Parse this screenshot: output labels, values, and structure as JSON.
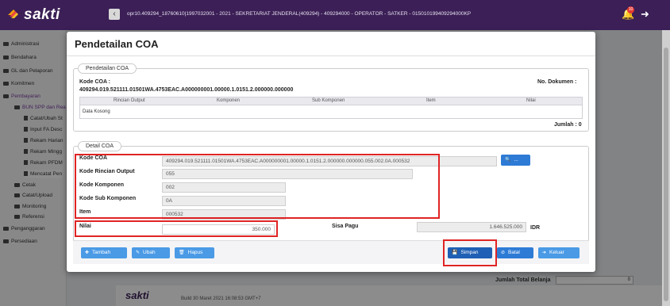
{
  "app": {
    "logo_text": "sakti",
    "context_line": "opr10.409294_18760610|1997032001 - 2021 - SEKRETARIAT JENDERAL(409294) - 409294000 - OPERATOR - SATKER - 015010199409294000KP",
    "notification_count": "10"
  },
  "sidebar": {
    "items": [
      {
        "label": "Administrasi"
      },
      {
        "label": "Bendahara"
      },
      {
        "label": "GL dan Pelaporan"
      },
      {
        "label": "Komitmen"
      },
      {
        "label": "Pembayaran"
      },
      {
        "label": "BUN SPP dan Rea"
      },
      {
        "label": "Catat/Ubah St"
      },
      {
        "label": "Input FA Desc"
      },
      {
        "label": "Rekam Harian"
      },
      {
        "label": "Rekam Mingg"
      },
      {
        "label": "Rekam PFDM"
      },
      {
        "label": "Mencatat Pen"
      },
      {
        "label": "Cetak"
      },
      {
        "label": "Catat/Upload"
      },
      {
        "label": "Monitoring"
      },
      {
        "label": "Referensi"
      },
      {
        "label": "Penganggaran"
      },
      {
        "label": "Persediaan"
      }
    ]
  },
  "background": {
    "footer_logo": "sakti",
    "build": "Build 30 Maret 2021 16:08:53 GMT+7",
    "total_belanja_label": "Jumlah Total Belanja",
    "total_belanja_value": "0"
  },
  "modal": {
    "title": "Pendetailan COA",
    "section1": {
      "legend": "Pendetailan COA",
      "kode_coa_label": "Kode COA :",
      "kode_coa_value": "409294.019.521111.01501WA.4753EAC.A000000001.00000.1.0151.2.000000.000000",
      "no_dokumen_label": "No. Dokumen :",
      "columns": [
        "Rincian Output",
        "Komponen",
        "Sub Komponen",
        "Item",
        "Nilai"
      ],
      "empty_text": "Data Kosong",
      "jumlah": "Jumlah : 0"
    },
    "section2": {
      "legend": "Detail COA",
      "kode_coa_label": "Kode COA",
      "kode_coa_value": "409294.019.521111.01501WA.4753EAC.A000000001.00000.1.0151.2.000000.000000.055.002.0A.000532",
      "search_label": "...",
      "rincian_label": "Kode Rincian Output",
      "rincian_value": "055",
      "komponen_label": "Kode Komponen",
      "komponen_value": "002",
      "sub_komponen_label": "Kode Sub Komponen",
      "sub_komponen_value": "0A",
      "item_label": "Item",
      "item_value": "000532",
      "nilai_label": "Nilai",
      "nilai_value": "350.000",
      "sisa_pagu_label": "Sisa Pagu",
      "sisa_pagu_value": "1.646.525.000",
      "currency": "IDR"
    },
    "buttons": {
      "tambah": "Tambah",
      "ubah": "Ubah",
      "hapus": "Hapus",
      "simpan": "Simpan",
      "batal": "Batal",
      "keluar": "Keluar"
    }
  },
  "colors": {
    "topbar": "#3b1f56",
    "button_blue": "#2e7bd6",
    "highlight_red": "#e02424"
  }
}
